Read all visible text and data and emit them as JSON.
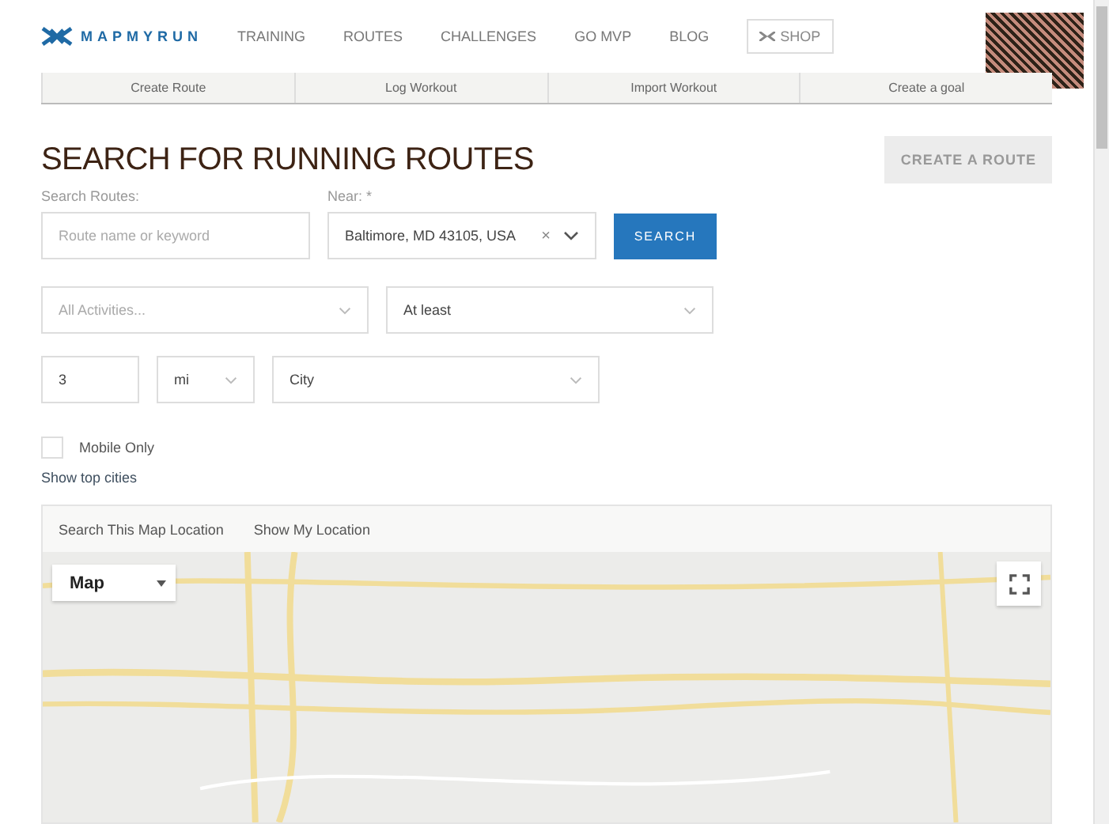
{
  "header": {
    "logo": "MAPMYRUN",
    "nav": [
      {
        "label": "TRAINING"
      },
      {
        "label": "ROUTES"
      },
      {
        "label": "CHALLENGES"
      },
      {
        "label": "GO MVP"
      },
      {
        "label": "BLOG"
      }
    ],
    "shop": "SHOP"
  },
  "subnav": [
    {
      "label": "Create Route"
    },
    {
      "label": "Log Workout"
    },
    {
      "label": "Import Workout"
    },
    {
      "label": "Create a goal"
    }
  ],
  "title": "SEARCH FOR RUNNING ROUTES",
  "create_button": "CREATE A ROUTE",
  "search_label": "Search Routes:",
  "search": {
    "placeholder": "Route name or keyword"
  },
  "near_label": "Near: *",
  "near": {
    "value": "Baltimore, MD 43105, USA",
    "clear": "×"
  },
  "search_button": "SEARCH",
  "activities": {
    "placeholder": "All Activities..."
  },
  "distance_mode": {
    "value": "At least"
  },
  "distance": {
    "value": "3"
  },
  "unit": {
    "value": "mi"
  },
  "route_type": {
    "value": "City"
  },
  "mobile_only": {
    "label": "Mobile Only",
    "checked": false
  },
  "top_cities_link": "Show top cities",
  "map_tabs": [
    {
      "label": "Search This Map Location"
    },
    {
      "label": "Show My Location"
    }
  ],
  "map": {
    "type_select": "Map"
  }
}
